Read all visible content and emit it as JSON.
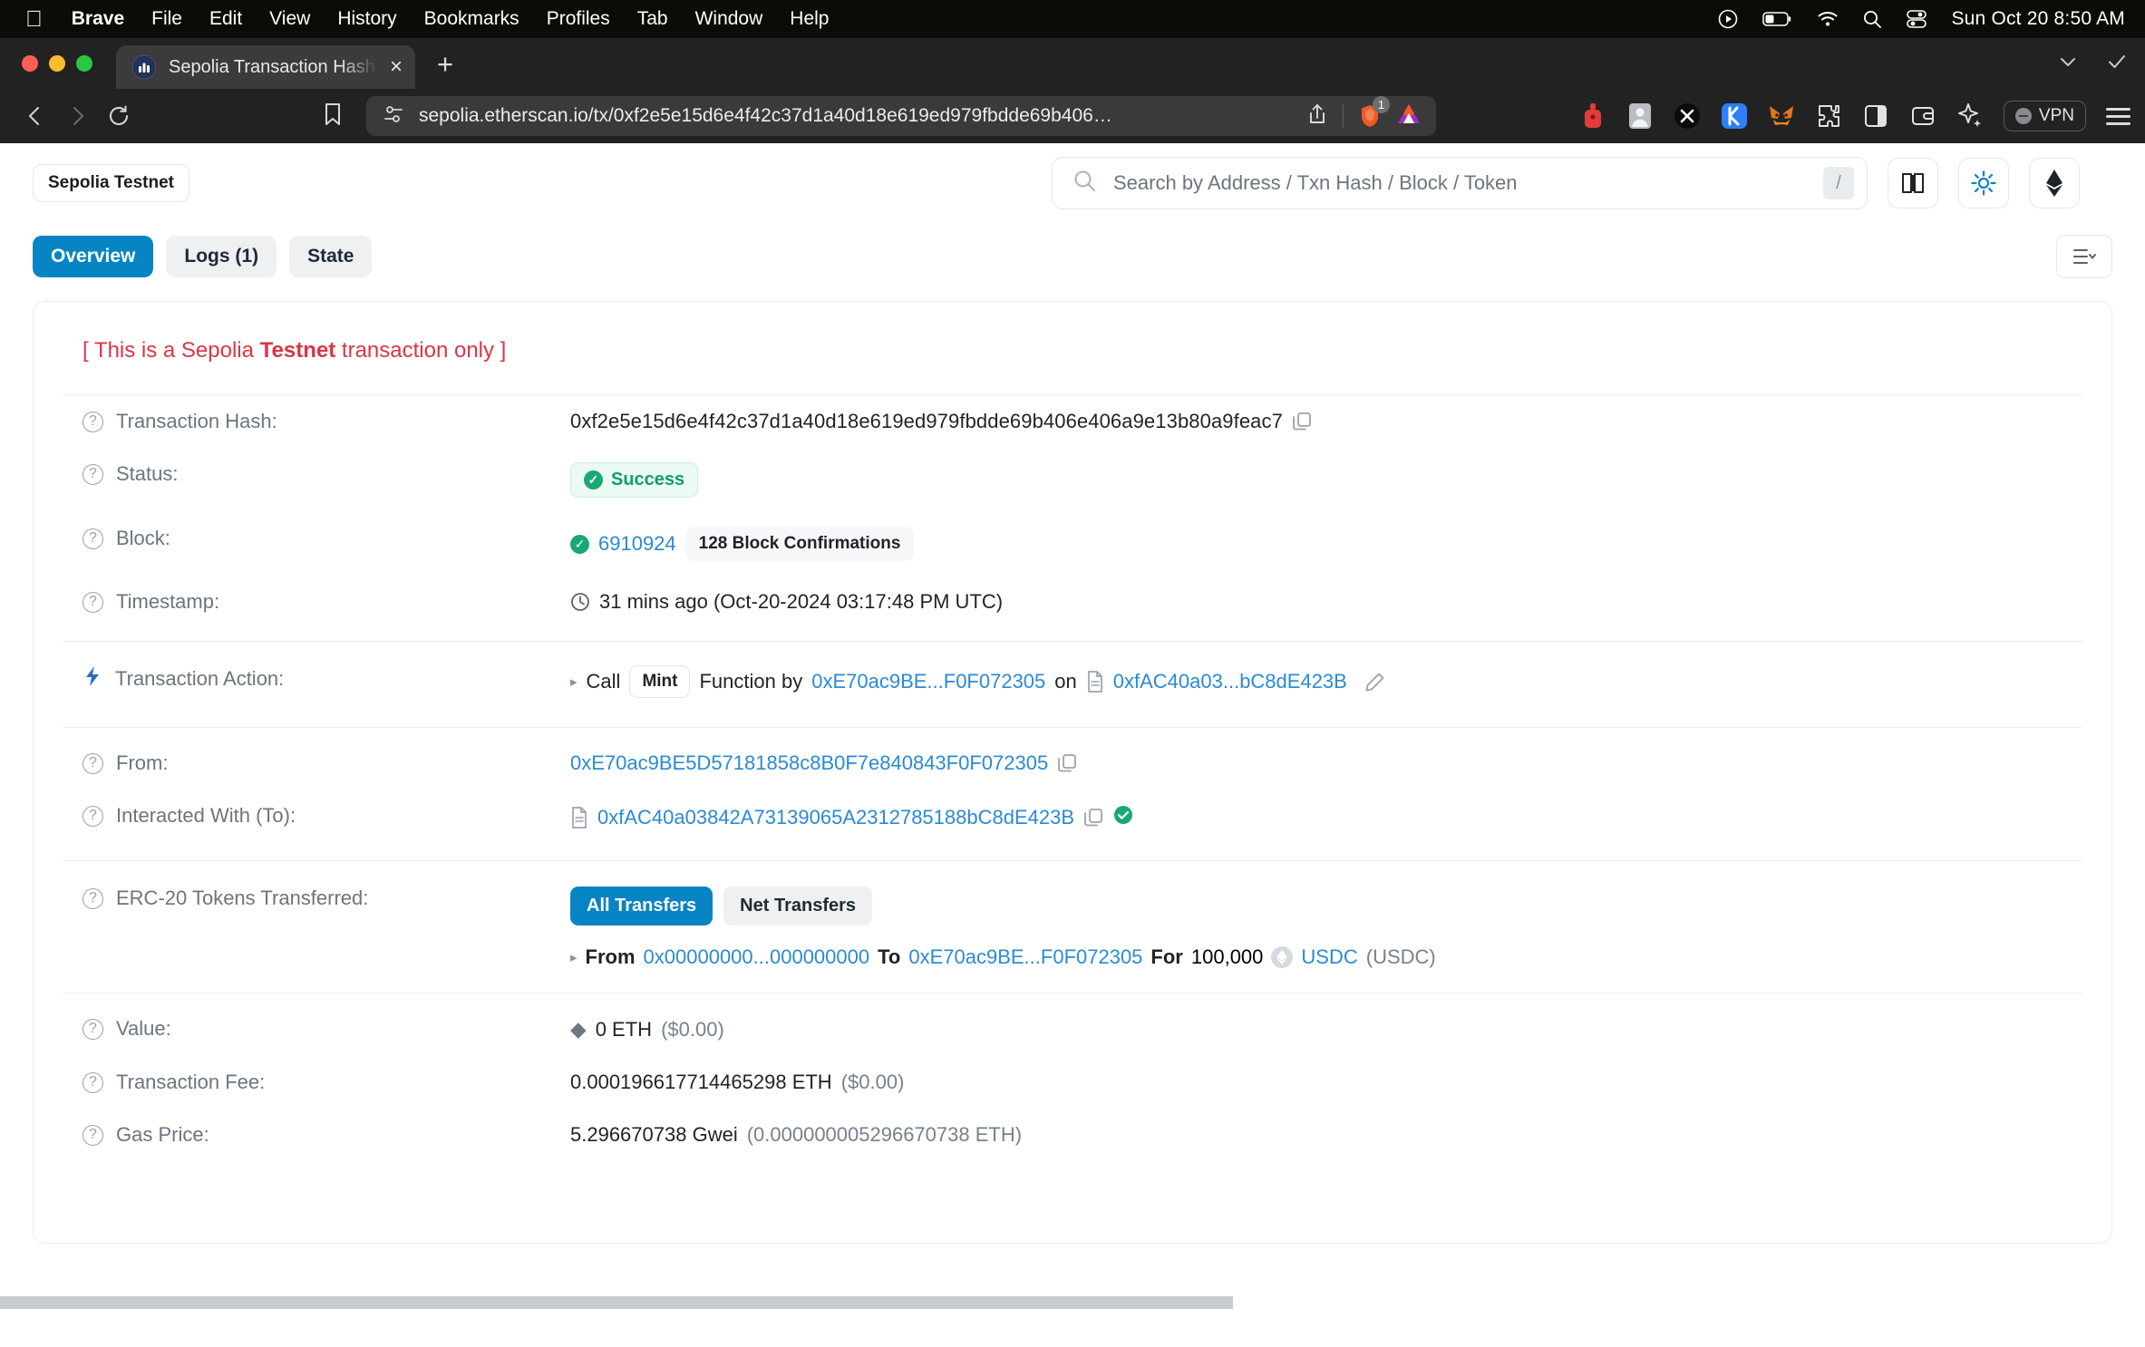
{
  "macos": {
    "apple_menu": "",
    "menus": [
      "Brave",
      "File",
      "Edit",
      "View",
      "History",
      "Bookmarks",
      "Profiles",
      "Tab",
      "Window",
      "Help"
    ],
    "status_icons": [
      "screen-record-icon",
      "battery-icon",
      "wifi-icon",
      "search-icon",
      "control-center-icon"
    ],
    "clock": "Sun Oct 20  8:50 AM"
  },
  "browser": {
    "tab_title": "Sepolia Transaction Hash (Tx",
    "tab_close_label": "×",
    "new_tab_label": "+",
    "url": "sepolia.etherscan.io/tx/0xf2e5e15d6e4f42c37d1a40d18e619ed979fbdde69b406…",
    "brave_shield_count": "1",
    "vpn_label": "VPN",
    "extensions": [
      "lock-icon",
      "profile-icon",
      "x-icon",
      "kalvium-k-icon",
      "metamask-fox-icon",
      "puzzle-piece-icon",
      "sidebar-icon",
      "wallet-icon",
      "leo-sparkle-icon"
    ]
  },
  "site": {
    "network_badge": "Sepolia Testnet",
    "search_placeholder": "Search by Address / Txn Hash / Block / Token",
    "search_shortcut": "/",
    "header_buttons": [
      "book-icon",
      "sun-theme-icon",
      "ethereum-icon"
    ]
  },
  "tabs": [
    {
      "label": "Overview",
      "active": true
    },
    {
      "label": "Logs (1)",
      "active": false
    },
    {
      "label": "State",
      "active": false
    }
  ],
  "transaction": {
    "testnet_note_prefix": "[ This is a Sepolia ",
    "testnet_note_bold": "Testnet",
    "testnet_note_suffix": " transaction only ]",
    "labels": {
      "hash": "Transaction Hash:",
      "status": "Status:",
      "block": "Block:",
      "timestamp": "Timestamp:",
      "action": "Transaction Action:",
      "from": "From:",
      "to": "Interacted With (To):",
      "erc20": "ERC-20 Tokens Transferred:",
      "value": "Value:",
      "fee": "Transaction Fee:",
      "gas_price": "Gas Price:"
    },
    "hash": "0xf2e5e15d6e4f42c37d1a40d18e619ed979fbdde69b406e406a9e13b80a9feac7",
    "status": "Success",
    "block_number": "6910924",
    "confirmations": "128 Block Confirmations",
    "timestamp": "31 mins ago (Oct-20-2024 03:17:48 PM UTC)",
    "action": {
      "call_word": "Call",
      "function_chip": "Mint",
      "function_word": "Function by",
      "caller": "0xE70ac9BE...F0F072305",
      "on_word": "on",
      "contract": "0xfAC40a03...bC8dE423B"
    },
    "from_address": "0xE70ac9BE5D57181858c8B0F7e840843F0F072305",
    "to_address": "0xfAC40a03842A73139065A2312785188bC8dE423B",
    "erc20": {
      "segments": [
        {
          "label": "All Transfers",
          "active": true
        },
        {
          "label": "Net Transfers",
          "active": false
        }
      ],
      "from_word": "From",
      "from_addr": "0x00000000...000000000",
      "to_word": "To",
      "to_addr": "0xE70ac9BE...F0F072305",
      "for_word": "For",
      "amount": "100,000",
      "token_symbol": "USDC",
      "token_name": "(USDC)"
    },
    "value": "0 ETH",
    "value_usd": "($0.00)",
    "fee": "0.000196617714465298 ETH",
    "fee_usd": "($0.00)",
    "gas_price": "5.296670738 Gwei",
    "gas_price_eth": "(0.000000005296670738 ETH)"
  },
  "colors": {
    "accent_blue": "#0784c3",
    "link_blue": "#2a8ad4",
    "success_green": "#19a974",
    "testnet_red": "#dc3545"
  }
}
